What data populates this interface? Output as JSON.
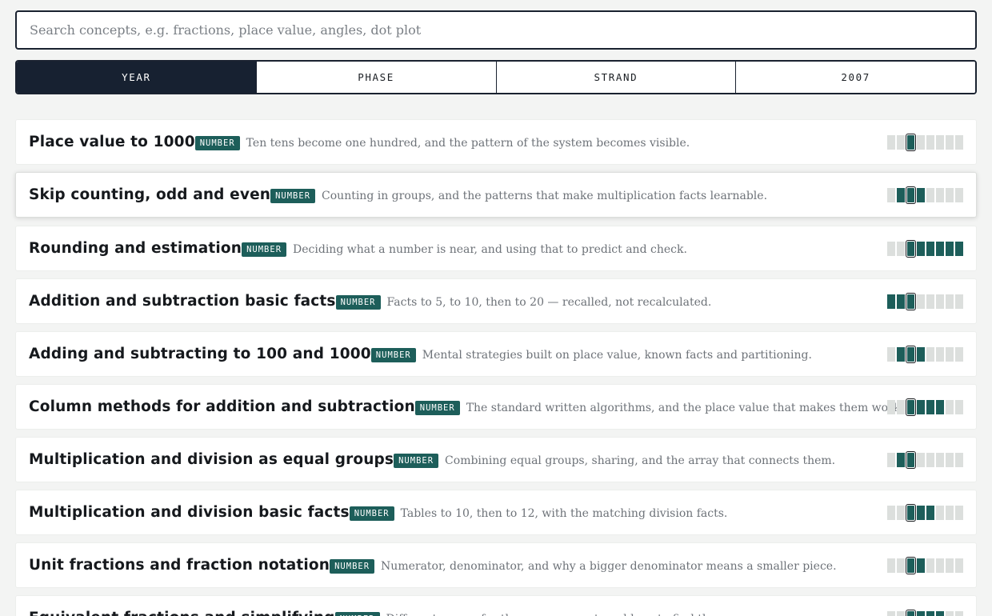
{
  "search": {
    "placeholder": "Search concepts, e.g. fractions, place value, angles, dot plot",
    "value": ""
  },
  "tabs": [
    {
      "label": "YEAR",
      "active": true
    },
    {
      "label": "PHASE",
      "active": false
    },
    {
      "label": "STRAND",
      "active": false
    },
    {
      "label": "2007",
      "active": false
    }
  ],
  "colors": {
    "accent": "#1d5e5a",
    "active_tab": "#172131",
    "meter_empty": "#dcdfdd"
  },
  "rows": [
    {
      "title": "Place value to 1000",
      "badge": "NUMBER",
      "desc": "Ten tens become one hundred, and the pattern of the system becomes visible.",
      "meter": {
        "cells": 8,
        "current": 3,
        "filled": [
          3
        ]
      }
    },
    {
      "title": "Skip counting, odd and even",
      "badge": "NUMBER",
      "desc": "Counting in groups, and the patterns that make multiplication facts learnable.",
      "meter": {
        "cells": 8,
        "current": 3,
        "filled": [
          2,
          3,
          4
        ]
      }
    },
    {
      "title": "Rounding and estimation",
      "badge": "NUMBER",
      "desc": "Deciding what a number is near, and using that to predict and check.",
      "meter": {
        "cells": 8,
        "current": 3,
        "filled": [
          3,
          4,
          5,
          6,
          7,
          8
        ]
      }
    },
    {
      "title": "Addition and subtraction basic facts",
      "badge": "NUMBER",
      "desc": "Facts to 5, to 10, then to 20 — recalled, not recalculated.",
      "meter": {
        "cells": 8,
        "current": 3,
        "filled": [
          1,
          2,
          3
        ]
      }
    },
    {
      "title": "Adding and subtracting to 100 and 1000",
      "badge": "NUMBER",
      "desc": "Mental strategies built on place value, known facts and partitioning.",
      "meter": {
        "cells": 8,
        "current": 3,
        "filled": [
          2,
          3,
          4
        ]
      }
    },
    {
      "title": "Column methods for addition and subtraction",
      "badge": "NUMBER",
      "desc": "The standard written algorithms, and the place value that makes them work.",
      "meter": {
        "cells": 8,
        "current": 3,
        "filled": [
          3,
          4,
          5,
          6
        ]
      }
    },
    {
      "title": "Multiplication and division as equal groups",
      "badge": "NUMBER",
      "desc": "Combining equal groups, sharing, and the array that connects them.",
      "meter": {
        "cells": 8,
        "current": 3,
        "filled": [
          2,
          3
        ]
      }
    },
    {
      "title": "Multiplication and division basic facts",
      "badge": "NUMBER",
      "desc": "Tables to 10, then to 12, with the matching division facts.",
      "meter": {
        "cells": 8,
        "current": 3,
        "filled": [
          3,
          4,
          5
        ]
      }
    },
    {
      "title": "Unit fractions and fraction notation",
      "badge": "NUMBER",
      "desc": "Numerator, denominator, and why a bigger denominator means a smaller piece.",
      "meter": {
        "cells": 8,
        "current": 3,
        "filled": [
          3,
          4
        ]
      }
    },
    {
      "title": "Equivalent fractions and simplifying",
      "badge": "NUMBER",
      "desc": "Different names for the same amount, and how to find them.",
      "meter": {
        "cells": 8,
        "current": 3,
        "filled": [
          3,
          4,
          5,
          6
        ]
      }
    }
  ]
}
